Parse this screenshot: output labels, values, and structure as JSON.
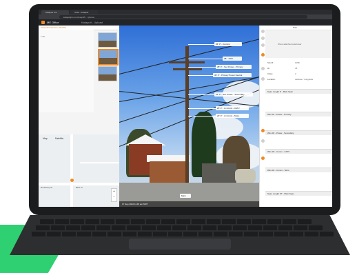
{
  "browser": {
    "tabs": [
      {
        "label": "Katapult Pro"
      },
      {
        "label": "OCR - Katapult"
      }
    ],
    "url": "katapultpro.com/map/#!/…/photos"
  },
  "app": {
    "name": "ME Office",
    "secondary": "Katapult - Upload",
    "filter_label": "Job Filter"
  },
  "left_panel": {
    "job_title": "Katapult/Collection 2022/09",
    "subtitle": "1 file"
  },
  "map": {
    "tabs": [
      "Map",
      "Satellite"
    ],
    "labels": [
      "Bluff St",
      "Broadway St"
    ]
  },
  "photo": {
    "annotations": [
      {
        "label": "26' 0\" - Comms"
      },
      {
        "label": "28' - DOC"
      },
      {
        "label": "28' 0\" - Sec Power - Primary"
      },
      {
        "label": "30' 0\" - Primary Power Neutral"
      },
      {
        "label": "31' 0\" - Sec Power - Secondary"
      },
      {
        "label": "25' 0\" - Lt Comm - CATV"
      },
      {
        "label": "23' 0\" - Lt Comm - Telco"
      }
    ],
    "caption": "Main",
    "timestamp": "17 Sep 2022 11:45 am MDT"
  },
  "right_panel": {
    "title": "Pole",
    "photo_placeholder": "Show attached pole/tower",
    "fields": [
      {
        "k": "Scid #",
        "v": "1098"
      },
      {
        "k": "Ht",
        "v": "45"
      },
      {
        "k": "Class",
        "v": "2"
      },
      {
        "k": "Location",
        "v": "Latitude / Longitude"
      }
    ],
    "sections": [
      {
        "title": "Span Length 0' - Main Span"
      },
      {
        "title": "Wire #1 - Power - Primary"
      },
      {
        "title": "Wire #2 - Power - Secondary"
      },
      {
        "title": "Wire #3 - Comm - CATV"
      },
      {
        "title": "Wire #4 - Comm - Telco"
      },
      {
        "title": "Span Length 97' - Main Span"
      }
    ]
  },
  "colors": {
    "accent": "#f08a24",
    "brand_green": "#2fd071",
    "laptop_body": "#1b1c1e"
  }
}
